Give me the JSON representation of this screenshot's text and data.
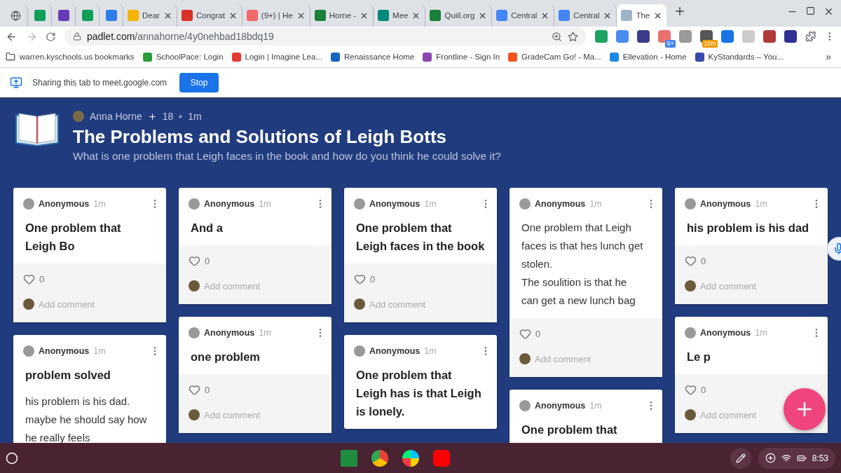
{
  "browser": {
    "tabs": [
      {
        "selected": false
      },
      {
        "selected": false
      },
      {
        "selected": false
      },
      {
        "selected": false
      },
      {
        "selected": false
      },
      {
        "title": "Dear",
        "selected": false
      },
      {
        "title": "Congrat",
        "selected": false
      },
      {
        "title": "(9+) | He",
        "selected": false
      },
      {
        "title": "Horne -",
        "selected": false
      },
      {
        "title": "Mee",
        "selected": false
      },
      {
        "title": "Quill.org",
        "selected": false
      },
      {
        "title": "Central",
        "selected": false
      },
      {
        "title": "Central",
        "selected": false
      },
      {
        "title": "The",
        "selected": true
      }
    ],
    "address": {
      "host": "padlet.com",
      "path": "/annahorne/4y0nehbad18bdq19"
    },
    "extension_badges": [
      "9+",
      "10m"
    ],
    "bookmarks": [
      "warren.kyschools.us bookmarks",
      "SchoolPace: Login",
      "Login | Imagine Lea...",
      "Renaissance Home",
      "Frontline - Sign In",
      "GradeCam Go! - Ma...",
      "Ellevation - Home",
      "KyStandards – You..."
    ],
    "bookmarks_more": "»"
  },
  "sharing_bar": {
    "message": "Sharing this tab to meet.google.com",
    "button": "Stop"
  },
  "padlet": {
    "author": "Anna Horne",
    "contributors": "18",
    "age": "1m",
    "title": "The Problems and Solutions of Leigh Botts",
    "description": "What is one problem that Leigh faces in the book and how do you think he could solve it?",
    "columns": [
      [
        {
          "author": "Anonymous",
          "age": "1m",
          "title": "One problem that\nLeigh Bo",
          "likes": "0",
          "comment_prompt": "Add comment"
        },
        {
          "author": "Anonymous",
          "age": "1m",
          "title": "problem solved",
          "body": "his problem is his dad.\nmaybe he should say how\nhe really feels"
        }
      ],
      [
        {
          "author": "Anonymous",
          "age": "1m",
          "title": "And a",
          "likes": "0",
          "comment_prompt": "Add comment"
        },
        {
          "author": "Anonymous",
          "age": "1m",
          "title": "one  problem",
          "likes": "0",
          "comment_prompt": "Add comment"
        }
      ],
      [
        {
          "author": "Anonymous",
          "age": "1m",
          "title": "One problem that\nLeigh faces in the book",
          "likes": "0",
          "comment_prompt": "Add comment"
        },
        {
          "author": "Anonymous",
          "age": "1m",
          "title": "One problem that\nLeigh has is that Leigh\nis lonely."
        }
      ],
      [
        {
          "author": "Anonymous",
          "age": "1m",
          "body": "One problem that Leigh\nfaces is that hes lunch get\nstolen.\nThe soulition  is that he\ncan get a new lunch bag",
          "likes": "0",
          "comment_prompt": "Add comment"
        },
        {
          "author": "Anonymous",
          "age": "1m",
          "title": "One problem that"
        }
      ],
      [
        {
          "author": "Anonymous",
          "age": "1m",
          "title": "his problem is his dad",
          "likes": "0",
          "comment_prompt": "Add comment"
        },
        {
          "author": "Anonymous",
          "age": "1m",
          "title": "Le p",
          "likes": "0",
          "comment_prompt": "Add comment"
        }
      ]
    ]
  },
  "shelf": {
    "time": "8:53"
  }
}
